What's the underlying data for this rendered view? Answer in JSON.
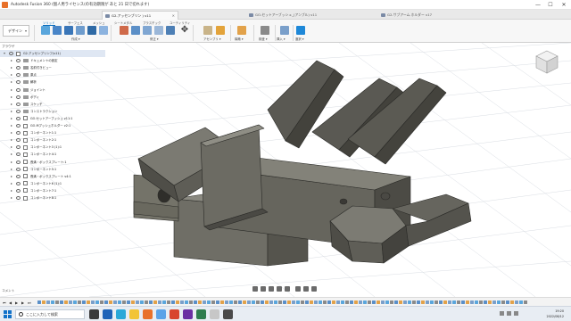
{
  "window": {
    "title": "Autodesk Fusion 360 (個人用ライセンス(の有効期限が あと 21 日で切れます)",
    "minimize": "—",
    "maximize": "☐",
    "close": "✕"
  },
  "doc_tabs": [
    {
      "label": "G2-アッセンブリン ) v11",
      "active": true
    },
    {
      "label": "GO-セットアーブッシュ_(アンブル) v11",
      "active": false
    },
    {
      "label": "G2-サブアーム.ホルダー v17",
      "active": false
    }
  ],
  "workspace": {
    "label": "デザイン"
  },
  "ribbon_tabs": [
    {
      "label": "ソリッド",
      "active": true
    },
    {
      "label": "サーフェス",
      "active": false
    },
    {
      "label": "メッシュ",
      "active": false
    },
    {
      "label": "シートメタル",
      "active": false
    },
    {
      "label": "プラスチック",
      "active": false
    },
    {
      "label": "ユーティリティ",
      "active": false
    }
  ],
  "ribbon_groups": [
    {
      "label": "作成 ▾"
    },
    {
      "label": "修正 ▾"
    },
    {
      "label": "アセンブリ ▾"
    },
    {
      "label": "構築 ▾"
    },
    {
      "label": "検査 ▾"
    },
    {
      "label": "挿入 ▾"
    },
    {
      "label": "選択 ▾"
    }
  ],
  "browser": {
    "header": "ブラウザ",
    "items": [
      {
        "label": "G2-アッセンブリンフ(v11)",
        "type": "root"
      },
      {
        "label": "ドキュメントの設定",
        "type": "folder"
      },
      {
        "label": "名前付きビュー",
        "type": "folder"
      },
      {
        "label": "原点",
        "type": "folder"
      },
      {
        "label": "解析",
        "type": "folder"
      },
      {
        "label": "ジョイント",
        "type": "folder"
      },
      {
        "label": "ボディ",
        "type": "folder"
      },
      {
        "label": "スケッチ",
        "type": "folder"
      },
      {
        "label": "コンストラクション",
        "type": "folder"
      },
      {
        "label": "GO-セットアーブッシュ v11:1",
        "type": "link"
      },
      {
        "label": "GO-Mブッシュホルダー v2:1",
        "type": "link"
      },
      {
        "label": "コンポーネント1:1",
        "type": "comp"
      },
      {
        "label": "コンポーネント2:1",
        "type": "comp"
      },
      {
        "label": "コンポーネント3 (1):1",
        "type": "comp"
      },
      {
        "label": "コンポーネント4:1",
        "type": "comp"
      },
      {
        "label": "長溝・ボックスプレート:1",
        "type": "comp"
      },
      {
        "label": "コンポーネント5:1",
        "type": "comp"
      },
      {
        "label": "長溝・ボックスプレート v4:1",
        "type": "comp"
      },
      {
        "label": "コンポーネント6 (1):1",
        "type": "comp"
      },
      {
        "label": "コンポーネント7:1",
        "type": "comp"
      },
      {
        "label": "コンポーネント8:1",
        "type": "comp"
      }
    ]
  },
  "comments_label": "コメント",
  "taskbar": {
    "search_placeholder": "ここに入力して検索",
    "time": "19:20",
    "date": "2022/08/12"
  },
  "colors": {
    "model_top": "#7b7a72",
    "model_side": "#5f5e57",
    "model_dark": "#3e3d38",
    "accent": "#0a6ebd",
    "brand": "#e8712a"
  }
}
